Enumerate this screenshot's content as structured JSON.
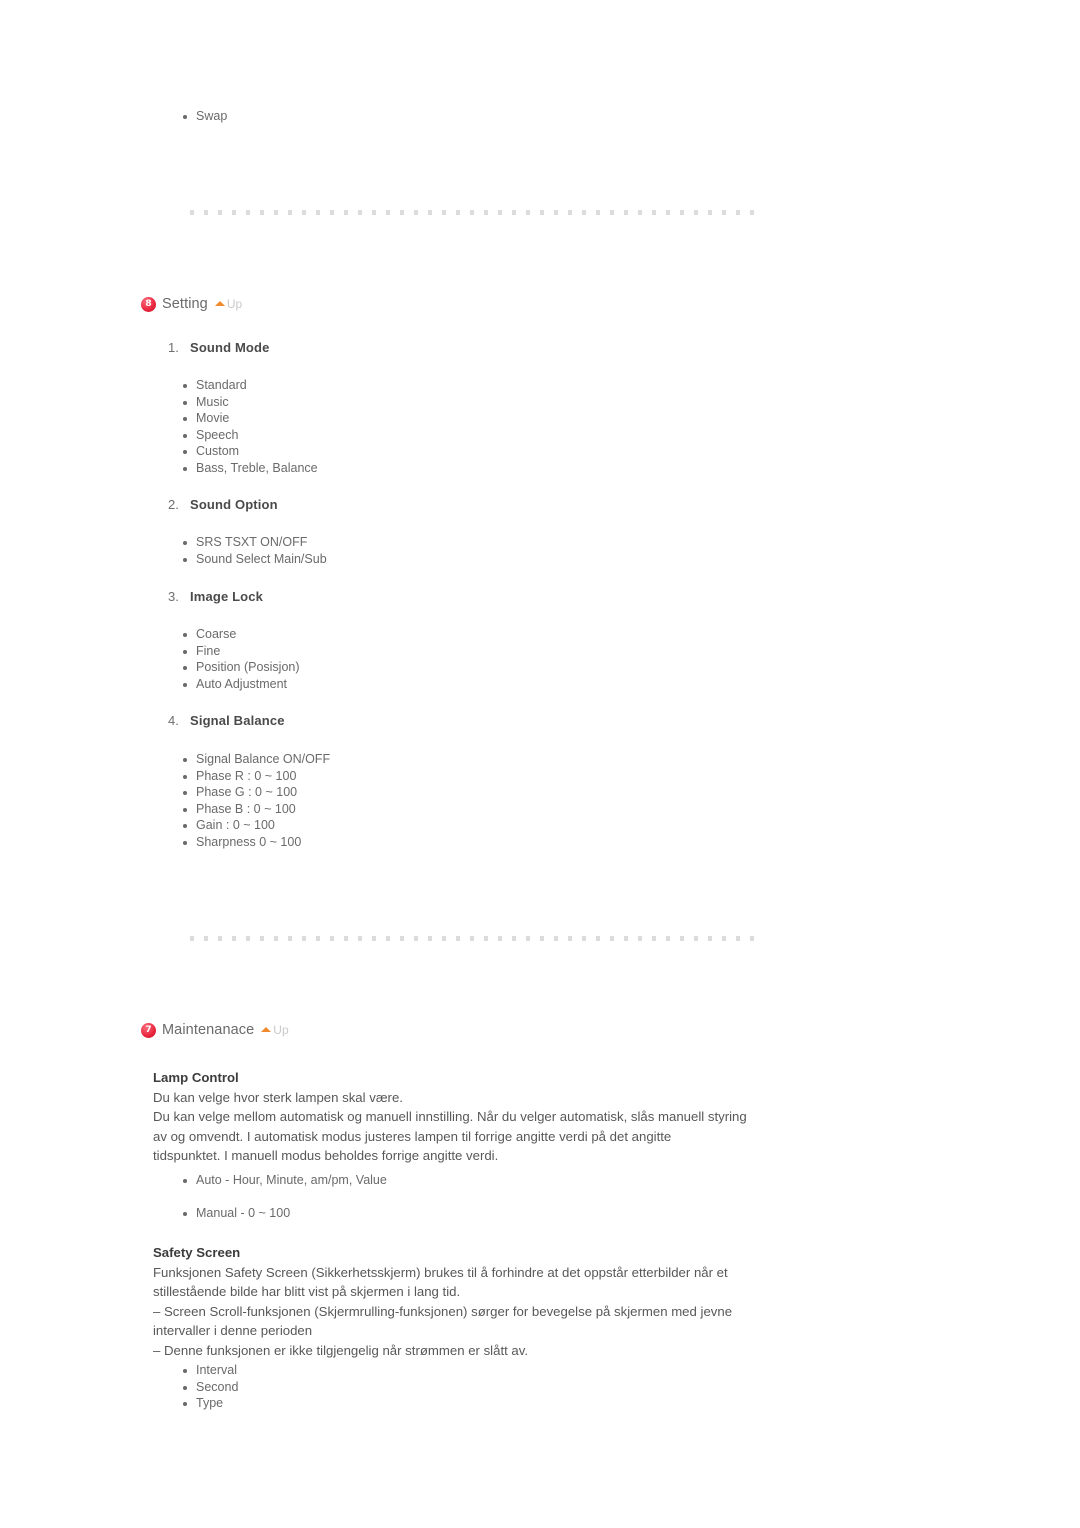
{
  "page": {
    "top_list": {
      "items": [
        "Swap"
      ]
    },
    "separators": [
      {
        "name": "separator-top"
      },
      {
        "name": "separator-middle"
      }
    ],
    "sections": [
      {
        "badge": "8",
        "title": "Setting",
        "up_label": "Up",
        "groups": [
          {
            "number": "1.",
            "label": "Sound Mode",
            "items": [
              "Standard",
              "Music",
              "Movie",
              "Speech",
              "Custom",
              "Bass, Treble, Balance"
            ]
          },
          {
            "number": "2.",
            "label": "Sound Option",
            "items": [
              "SRS TSXT ON/OFF",
              "Sound Select Main/Sub"
            ]
          },
          {
            "number": "3.",
            "label": "Image Lock",
            "items": [
              "Coarse",
              "Fine",
              "Position (Posisjon)",
              "Auto Adjustment"
            ]
          },
          {
            "number": "4.",
            "label": "Signal Balance",
            "items": [
              "Signal Balance ON/OFF",
              "Phase R : 0 ~ 100",
              "Phase G : 0 ~ 100",
              "Phase B : 0 ~ 100",
              "Gain : 0 ~ 100",
              "Sharpness 0 ~ 100"
            ]
          }
        ]
      },
      {
        "badge": "7",
        "title": "Maintenanace",
        "up_label": "Up",
        "topics": [
          {
            "title": "Lamp Control",
            "lines": [
              "Du kan velge hvor sterk lampen skal være.",
              "Du kan velge mellom automatisk og manuell innstilling. Når du velger automatisk, slås manuell styring",
              "av og omvendt. I automatisk modus justeres lampen til forrige angitte verdi på det angitte",
              "tidspunktet. I manuell modus beholdes forrige angitte verdi."
            ],
            "items": [
              "Auto - Hour, Minute, am/pm, Value",
              "Manual - 0 ~ 100"
            ]
          },
          {
            "title": "Safety Screen",
            "lines": [
              "Funksjonen Safety Screen (Sikkerhetsskjerm) brukes til å forhindre at det oppstår etterbilder når et",
              "stillestående bilde har blitt vist på skjermen i lang tid.",
              "– Screen Scroll-funksjonen (Skjermrulling-funksjonen) sørger for bevegelse på skjermen med jevne",
              "intervaller i denne perioden",
              "– Denne funksjonen er ikke tilgjengelig når strømmen er slått av."
            ],
            "items": [
              "Interval",
              "Second",
              "Type"
            ]
          }
        ]
      }
    ]
  },
  "colors": {
    "badge_red": "#e8243b",
    "caret_orange": "#ef8b2c",
    "separator_gray": "#dcdcdc",
    "text_gray": "#6a6a6a"
  }
}
